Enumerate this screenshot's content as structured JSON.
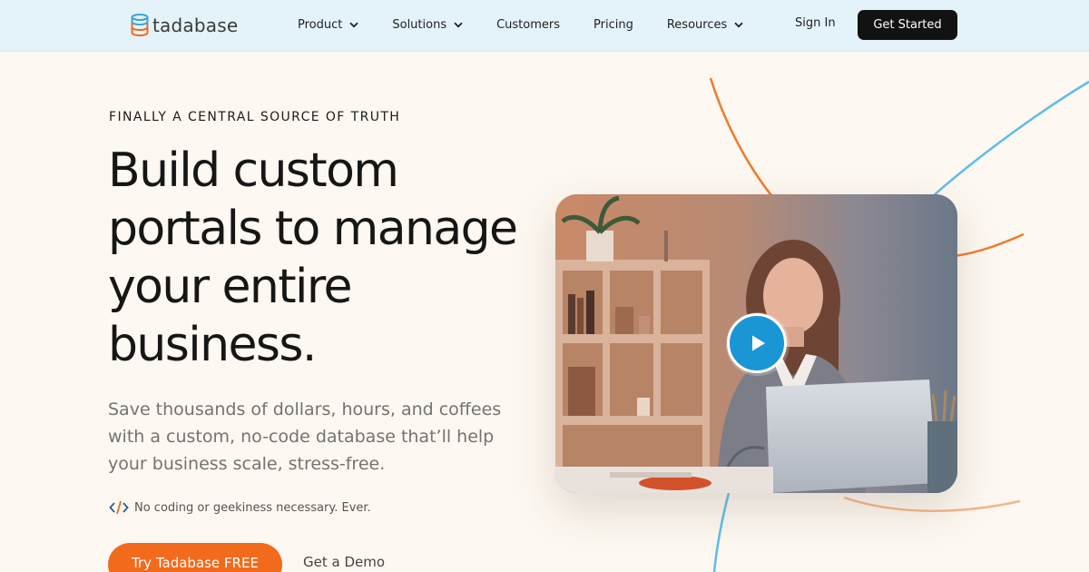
{
  "brand": {
    "name": "tadabase",
    "logo_colors": [
      "#3aa4d8",
      "#f26a1b"
    ]
  },
  "nav": {
    "items": [
      {
        "label": "Product",
        "has_dropdown": true
      },
      {
        "label": "Solutions",
        "has_dropdown": true
      },
      {
        "label": "Customers",
        "has_dropdown": false
      },
      {
        "label": "Pricing",
        "has_dropdown": false
      },
      {
        "label": "Resources",
        "has_dropdown": true
      }
    ],
    "sign_in": "Sign In",
    "get_started": "Get Started"
  },
  "hero": {
    "eyebrow": "FINALLY A CENTRAL SOURCE OF TRUTH",
    "headline": "Build custom portals to manage your entire business.",
    "subtext": "Save thousands of dollars, hours, and coffees with a custom, no-code database that’ll help your business scale, stress-free.",
    "note": "No coding or geekiness necessary. Ever.",
    "primary_cta": "Try Tadabase FREE",
    "secondary_cta": "Get a Demo"
  },
  "video": {
    "play_icon": "play-icon"
  },
  "colors": {
    "header_bg": "#e4f3f9",
    "page_bg": "#fdf8f1",
    "accent_orange": "#f26a1b",
    "accent_blue": "#1a96d4",
    "button_dark": "#121212"
  }
}
